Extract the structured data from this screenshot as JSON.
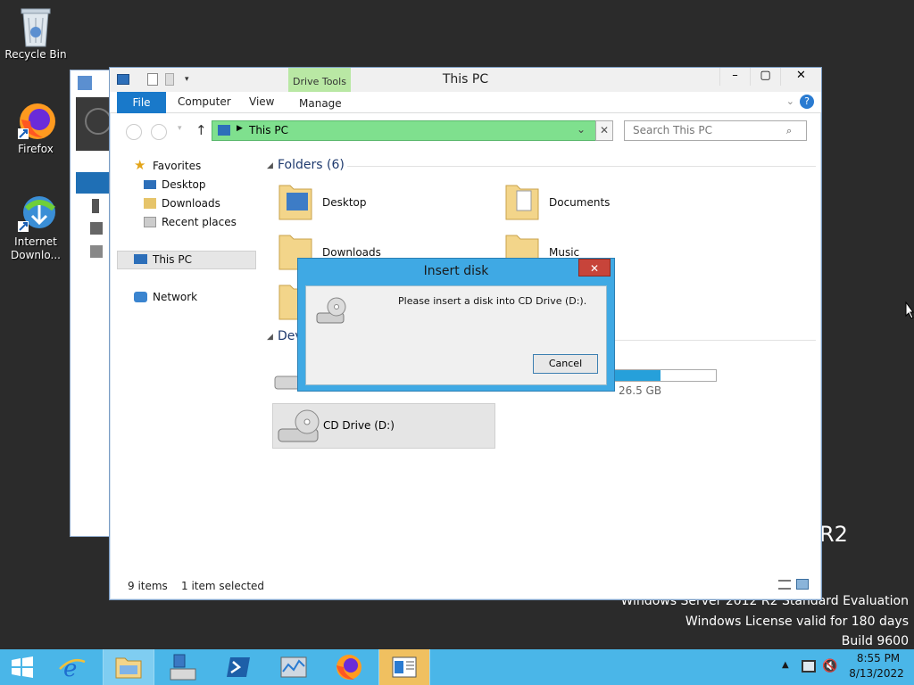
{
  "desktop": {
    "icons": [
      {
        "label": "Recycle Bin",
        "icon": "recycle-bin-icon"
      },
      {
        "label": "Firefox",
        "icon": "firefox-icon"
      },
      {
        "label": "Internet Downlo...",
        "icon": "internet-download-manager-icon"
      }
    ],
    "watermark": {
      "partial": "R2",
      "line1": "Windows Server 2012 R2 Standard Evaluation",
      "line2": "Windows License valid for 180 days",
      "line3": "Build 9600"
    }
  },
  "explorer": {
    "title": "This PC",
    "context_tab": "Drive Tools",
    "tabs": [
      "File",
      "Computer",
      "View",
      "Manage"
    ],
    "address": "This PC",
    "search_placeholder": "Search This PC",
    "nav": {
      "favorites": "Favorites",
      "desktop": "Desktop",
      "downloads": "Downloads",
      "recent": "Recent places",
      "this_pc": "This PC",
      "network": "Network"
    },
    "folders_header": "Folders (6)",
    "folders": [
      "Desktop",
      "Documents",
      "Downloads",
      "Music"
    ],
    "devices_header": "Dev",
    "devices": {
      "local_disk_free": "26.5 GB",
      "cd_drive": "CD Drive (D:)"
    },
    "status": {
      "items": "9 items",
      "selected": "1 item selected"
    }
  },
  "dialog": {
    "title": "Insert disk",
    "message": "Please insert a disk into CD Drive (D:).",
    "cancel": "Cancel"
  },
  "taskbar": {
    "time": "8:55 PM",
    "date": "8/13/2022"
  },
  "colors": {
    "taskbar": "#4ab6e8",
    "dialog_border": "#3fa9e4",
    "address_bar": "#7fe08e",
    "file_tab": "#1979ca",
    "drive_tools": "#b9e8a4"
  }
}
